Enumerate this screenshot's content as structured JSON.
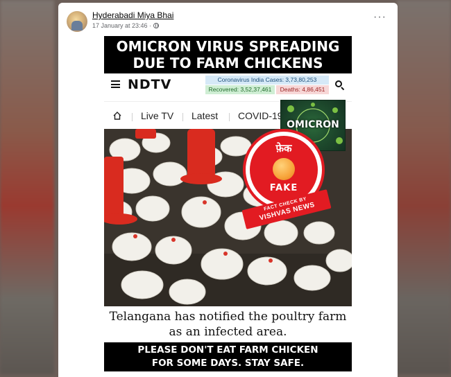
{
  "post": {
    "author": "Hyderabadi Miya Bhai",
    "timestamp": "17 January at 23:46 ·",
    "more_icon": "ellipsis-icon",
    "privacy_icon": "globe-icon"
  },
  "image": {
    "headline_line1": "OMICRON VIRUS SPREADING",
    "headline_line2": "DUE TO FARM CHICKENS",
    "ndtv": {
      "logo": "NDTV",
      "cases": "Coronavirus India Cases: 3,73,80,253",
      "recovered": "Recovered: 3,52,37,461",
      "deaths": "Deaths: 4,86,451"
    },
    "nav": [
      "Live TV",
      "Latest",
      "COVID-19"
    ],
    "omicron_label": "OMICRON",
    "caption_line1": "Telangana has notified the poultry farm",
    "caption_line2": "as an infected area.",
    "footer_line1": "PLEASE DON'T EAT FARM CHICKEN",
    "footer_line2": "FOR SOME DAYS. STAY SAFE."
  },
  "stamp": {
    "hindi": "फ़ेक",
    "fake": "FAKE",
    "ribbon_line1": "FACT CHECK BY",
    "ribbon_line2": "VISHVAS NEWS"
  },
  "colors": {
    "stamp_red": "#e21b22",
    "banner_black": "#000000"
  }
}
